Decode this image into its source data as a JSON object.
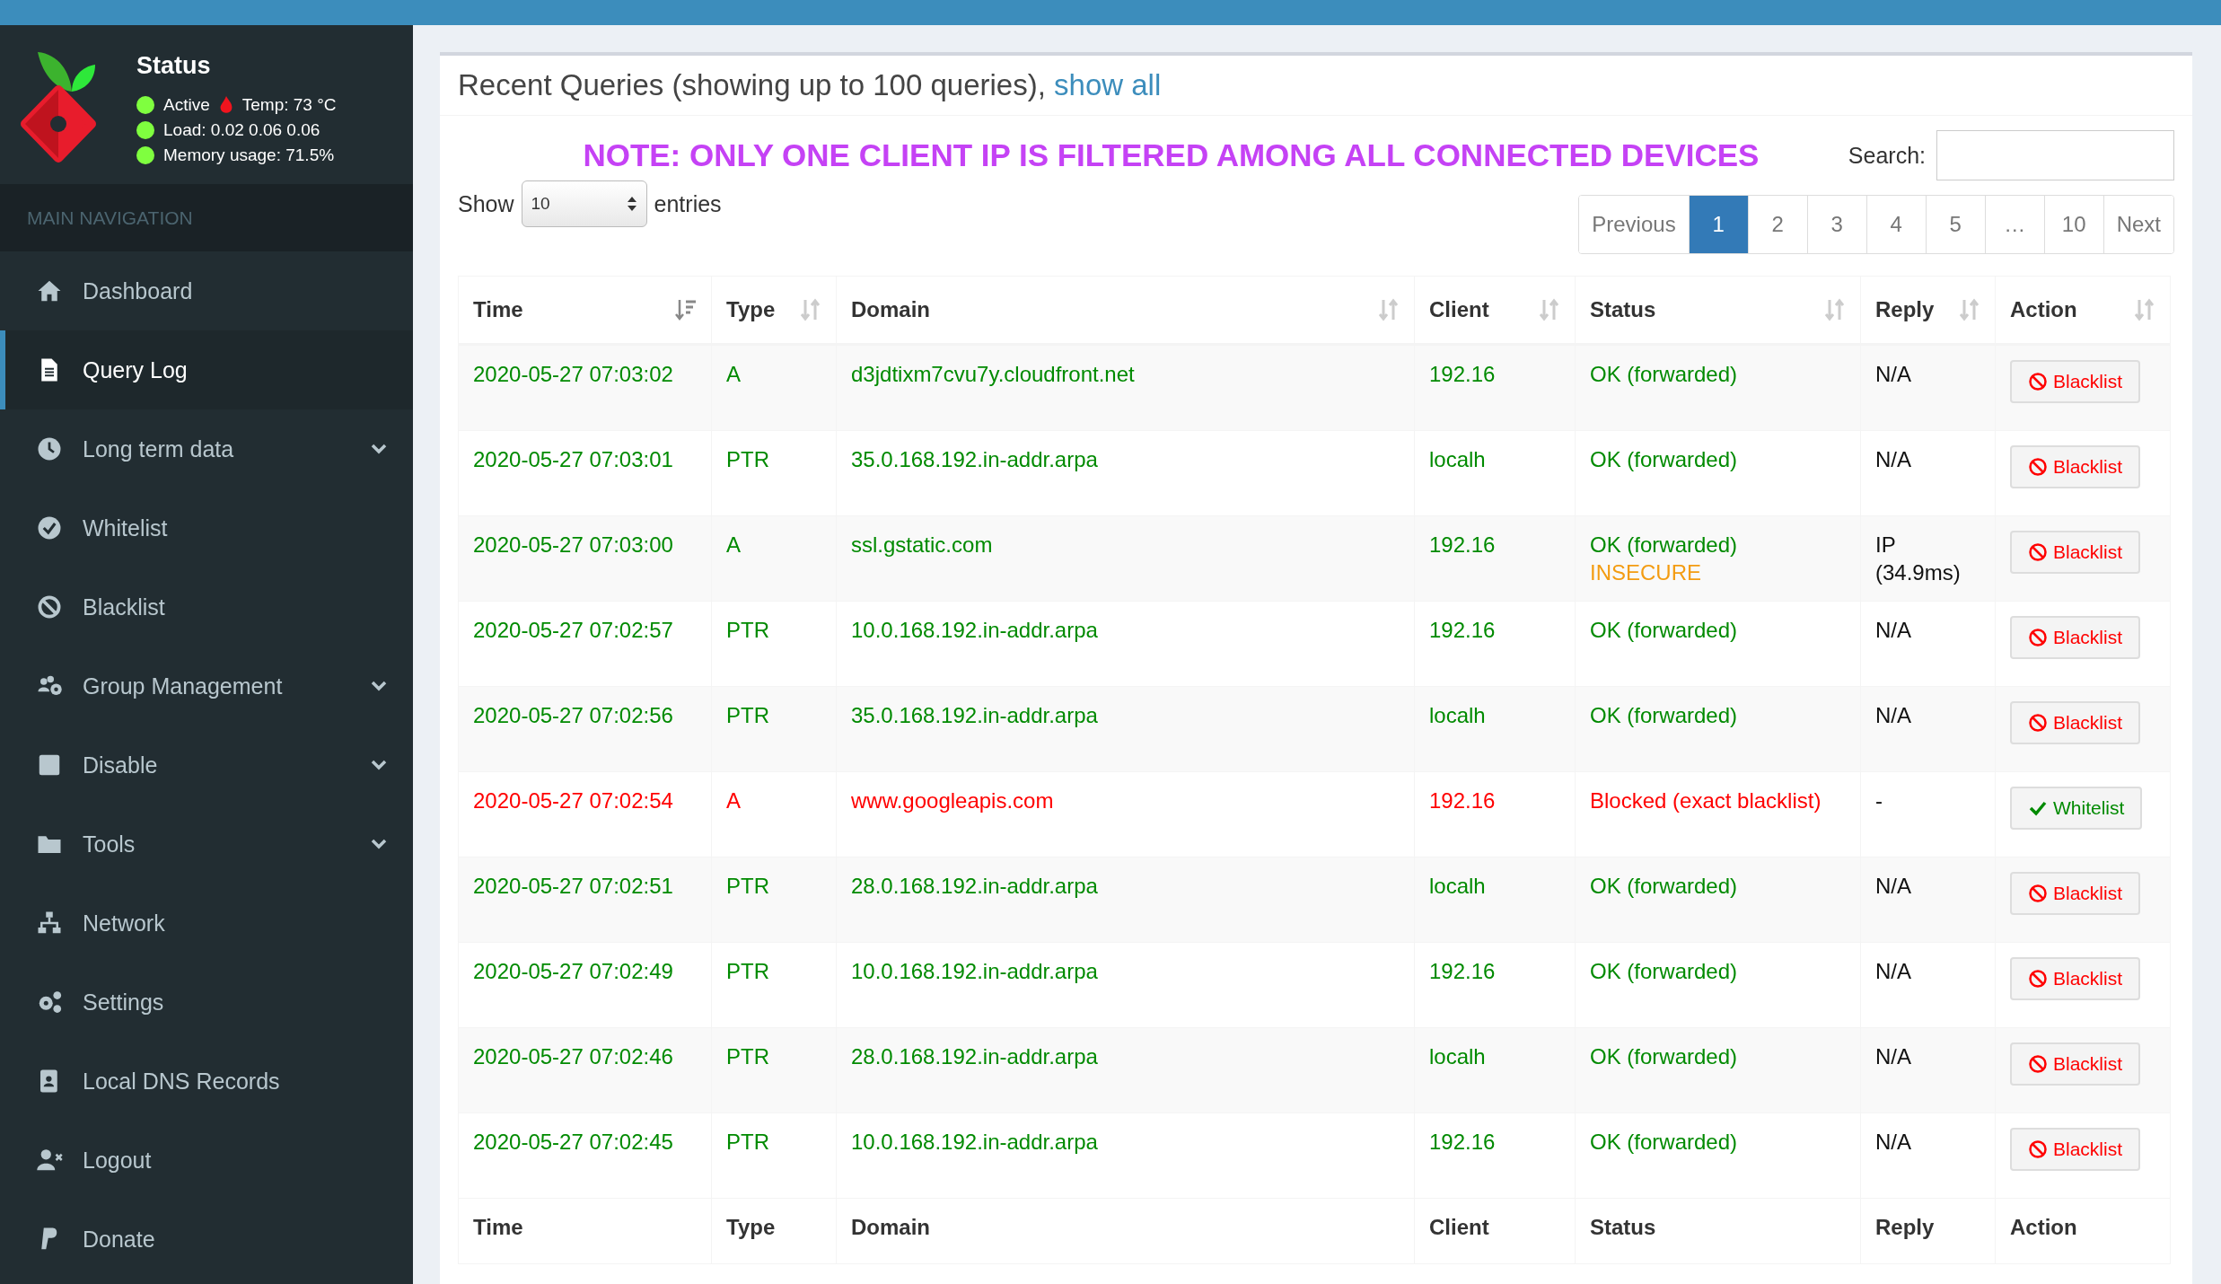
{
  "sidebar": {
    "status": {
      "title": "Status",
      "lines": [
        "Active",
        "Load:  0.02  0.06  0.06",
        "Memory usage:  71.5%"
      ],
      "temp": "Temp: 73 °C"
    },
    "section": "MAIN NAVIGATION",
    "items": [
      {
        "label": "Dashboard",
        "selected": false,
        "expandable": false
      },
      {
        "label": "Query Log",
        "selected": true,
        "expandable": false
      },
      {
        "label": "Long term data",
        "selected": false,
        "expandable": true
      },
      {
        "label": "Whitelist",
        "selected": false,
        "expandable": false
      },
      {
        "label": "Blacklist",
        "selected": false,
        "expandable": false
      },
      {
        "label": "Group Management",
        "selected": false,
        "expandable": true
      },
      {
        "label": "Disable",
        "selected": false,
        "expandable": true
      },
      {
        "label": "Tools",
        "selected": false,
        "expandable": true
      },
      {
        "label": "Network",
        "selected": false,
        "expandable": false
      },
      {
        "label": "Settings",
        "selected": false,
        "expandable": false
      },
      {
        "label": "Local DNS Records",
        "selected": false,
        "expandable": false
      },
      {
        "label": "Logout",
        "selected": false,
        "expandable": false
      },
      {
        "label": "Donate",
        "selected": false,
        "expandable": false
      }
    ]
  },
  "card": {
    "title": "Recent Queries (showing up to 100 queries),",
    "title_link": "show all",
    "note": "NOTE: ONLY ONE CLIENT IP IS FILTERED AMONG ALL CONNECTED DEVICES",
    "show_label": "Show",
    "show_value": "10",
    "entries_label": "entries",
    "search_label": "Search:",
    "pagination": [
      {
        "label": "Previous",
        "selected": false
      },
      {
        "label": "1",
        "selected": true
      },
      {
        "label": "2",
        "selected": false
      },
      {
        "label": "3",
        "selected": false
      },
      {
        "label": "4",
        "selected": false
      },
      {
        "label": "5",
        "selected": false
      },
      {
        "label": "…",
        "selected": false
      },
      {
        "label": "10",
        "selected": false
      },
      {
        "label": "Next",
        "selected": false
      }
    ],
    "table": {
      "columns": [
        {
          "label": "Time",
          "sorted": true
        },
        {
          "label": "Type",
          "sorted": false
        },
        {
          "label": "Domain",
          "sorted": false
        },
        {
          "label": "Client",
          "sorted": false
        },
        {
          "label": "Status",
          "sorted": false
        },
        {
          "label": "Reply",
          "sorted": false
        },
        {
          "label": "Action",
          "sorted": false
        }
      ],
      "rows": [
        {
          "time": "2020-05-27 07:03:02",
          "type": "A",
          "domain": "d3jdtixm7cvu7y.cloudfront.net",
          "client": "192.16",
          "status": "OK (forwarded)",
          "reply": "N/A",
          "blocked": false,
          "action": "Blacklist"
        },
        {
          "time": "2020-05-27 07:03:01",
          "type": "PTR",
          "domain": "35.0.168.192.in-addr.arpa",
          "client": "localh",
          "status": "OK (forwarded)",
          "reply": "N/A",
          "blocked": false,
          "action": "Blacklist"
        },
        {
          "time": "2020-05-27 07:03:00",
          "type": "A",
          "domain": "ssl.gstatic.com",
          "client": "192.16",
          "status": "OK (forwarded)",
          "status_note": "INSECURE",
          "reply": "IP (34.9ms)",
          "blocked": false,
          "action": "Blacklist"
        },
        {
          "time": "2020-05-27 07:02:57",
          "type": "PTR",
          "domain": "10.0.168.192.in-addr.arpa",
          "client": "192.16",
          "status": "OK (forwarded)",
          "reply": "N/A",
          "blocked": false,
          "action": "Blacklist"
        },
        {
          "time": "2020-05-27 07:02:56",
          "type": "PTR",
          "domain": "35.0.168.192.in-addr.arpa",
          "client": "localh",
          "status": "OK (forwarded)",
          "reply": "N/A",
          "blocked": false,
          "action": "Blacklist"
        },
        {
          "time": "2020-05-27 07:02:54",
          "type": "A",
          "domain": "www.googleapis.com",
          "client": "192.16",
          "status": "Blocked (exact blacklist)",
          "reply": "-",
          "blocked": true,
          "action": "Whitelist"
        },
        {
          "time": "2020-05-27 07:02:51",
          "type": "PTR",
          "domain": "28.0.168.192.in-addr.arpa",
          "client": "localh",
          "status": "OK (forwarded)",
          "reply": "N/A",
          "blocked": false,
          "action": "Blacklist"
        },
        {
          "time": "2020-05-27 07:02:49",
          "type": "PTR",
          "domain": "10.0.168.192.in-addr.arpa",
          "client": "192.16",
          "status": "OK (forwarded)",
          "reply": "N/A",
          "blocked": false,
          "action": "Blacklist"
        },
        {
          "time": "2020-05-27 07:02:46",
          "type": "PTR",
          "domain": "28.0.168.192.in-addr.arpa",
          "client": "localh",
          "status": "OK (forwarded)",
          "reply": "N/A",
          "blocked": false,
          "action": "Blacklist"
        },
        {
          "time": "2020-05-27 07:02:45",
          "type": "PTR",
          "domain": "10.0.168.192.in-addr.arpa",
          "client": "192.16",
          "status": "OK (forwarded)",
          "reply": "N/A",
          "blocked": false,
          "action": "Blacklist"
        }
      ],
      "footer": [
        "Time",
        "Type",
        "Domain",
        "Client",
        "Status",
        "Reply",
        "Action"
      ]
    }
  }
}
